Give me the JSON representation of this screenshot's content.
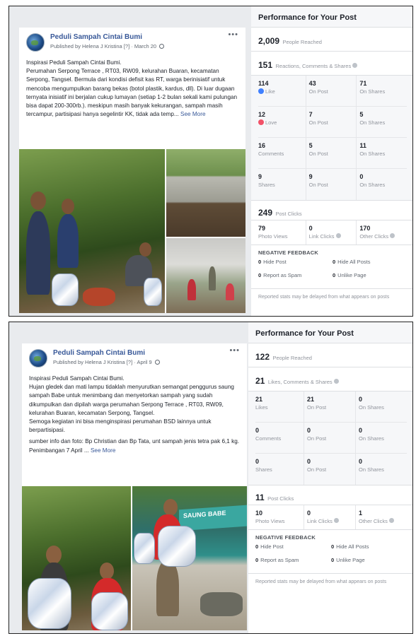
{
  "posts": [
    {
      "page_name": "Peduli Sampah Cintai Bumi",
      "published_by": "Published by Helena J Kristina",
      "badge": "[?]",
      "date": "March 20",
      "text": [
        "Inspirasi Peduli Sampah Cintai Bumi.",
        "Perumahan Serpong Terrace , RT03, RW09, kelurahan Buaran, kecamatan Serpong, Tangsel. Bermula dari kondisi defisit kas RT, warga berinisiatif untuk mencoba mengumpulkan barang bekas (botol plastik, kardus, dll). Di luar dugaan ternyata inisiatif ini berjalan cukup lumayan (setiap 1-2 bulan sekali kami pulungan bisa dapat 200-300rb.). meskipun masih banyak kekurangan, sampah masih tercampur, partisipasi hanya segelintir KK, tidak ada temp..."
      ],
      "see_more": "See More",
      "performance": {
        "title": "Performance for Your Post",
        "people_reached": "2,009",
        "people_reached_label": "People Reached",
        "reactions_total": "151",
        "reactions_label": "Reactions, Comments & Shares",
        "grid": [
          [
            {
              "n": "114",
              "t": "Like",
              "icon": "like-icon"
            },
            {
              "n": "43",
              "t": "On Post"
            },
            {
              "n": "71",
              "t": "On Shares"
            }
          ],
          [
            {
              "n": "12",
              "t": "Love",
              "icon": "love-icon"
            },
            {
              "n": "7",
              "t": "On Post"
            },
            {
              "n": "5",
              "t": "On Shares"
            }
          ],
          [
            {
              "n": "16",
              "t": "Comments"
            },
            {
              "n": "5",
              "t": "On Post"
            },
            {
              "n": "11",
              "t": "On Shares"
            }
          ],
          [
            {
              "n": "9",
              "t": "Shares"
            },
            {
              "n": "9",
              "t": "On Post"
            },
            {
              "n": "0",
              "t": "On Shares"
            }
          ]
        ],
        "post_clicks": "249",
        "post_clicks_label": "Post Clicks",
        "clicks": [
          {
            "n": "79",
            "t": "Photo Views"
          },
          {
            "n": "0",
            "t": "Link Clicks"
          },
          {
            "n": "170",
            "t": "Other Clicks"
          }
        ],
        "negative_title": "NEGATIVE FEEDBACK",
        "negative": [
          {
            "n": "0",
            "t": "Hide Post"
          },
          {
            "n": "0",
            "t": "Hide All Posts"
          },
          {
            "n": "0",
            "t": "Report as Spam"
          },
          {
            "n": "0",
            "t": "Unlike Page"
          }
        ],
        "footer": "Reported stats may be delayed from what appears on posts"
      }
    },
    {
      "page_name": "Peduli Sampah Cintai Bumi",
      "published_by": "Published by Helena J Kristina",
      "badge": "[?]",
      "date": "April 9",
      "text": [
        "Inspirasi Peduli Sampah Cintai Bumi.",
        "Hujan gledek dan mati lampu tidaklah menyurutkan semangat penggurus saung sampah Babe untuk menimbang dan menyetorkan sampah yang sudah dikumpulkan dan dipilah warga perumahan Serpong Terrace , RT03, RW09, kelurahan Buaran, kecamatan Serpong, Tangsel.",
        "Semoga kegiatan ini bisa menginspirasi perumahan BSD lainnya untuk berpartisipasi.",
        "sumber info dan foto: Bp Christian dan Bp Tata, unt sampah jenis tetra pak 6,1 kg. Penimbangan 7 April ..."
      ],
      "see_more": "See More",
      "photo_sign": "SAUNG BABE",
      "performance": {
        "title": "Performance for Your Post",
        "people_reached": "122",
        "people_reached_label": "People Reached",
        "reactions_total": "21",
        "reactions_label": "Likes, Comments & Shares",
        "grid": [
          [
            {
              "n": "21",
              "t": "Likes"
            },
            {
              "n": "21",
              "t": "On Post"
            },
            {
              "n": "0",
              "t": "On Shares"
            }
          ],
          [
            {
              "n": "0",
              "t": "Comments"
            },
            {
              "n": "0",
              "t": "On Post"
            },
            {
              "n": "0",
              "t": "On Shares"
            }
          ],
          [
            {
              "n": "0",
              "t": "Shares"
            },
            {
              "n": "0",
              "t": "On Post"
            },
            {
              "n": "0",
              "t": "On Shares"
            }
          ]
        ],
        "post_clicks": "11",
        "post_clicks_label": "Post Clicks",
        "clicks": [
          {
            "n": "10",
            "t": "Photo Views"
          },
          {
            "n": "0",
            "t": "Link Clicks"
          },
          {
            "n": "1",
            "t": "Other Clicks"
          }
        ],
        "negative_title": "NEGATIVE FEEDBACK",
        "negative": [
          {
            "n": "0",
            "t": "Hide Post"
          },
          {
            "n": "0",
            "t": "Hide All Posts"
          },
          {
            "n": "0",
            "t": "Report as Spam"
          },
          {
            "n": "0",
            "t": "Unlike Page"
          }
        ],
        "footer": "Reported stats may be delayed from what appears on posts"
      }
    }
  ]
}
